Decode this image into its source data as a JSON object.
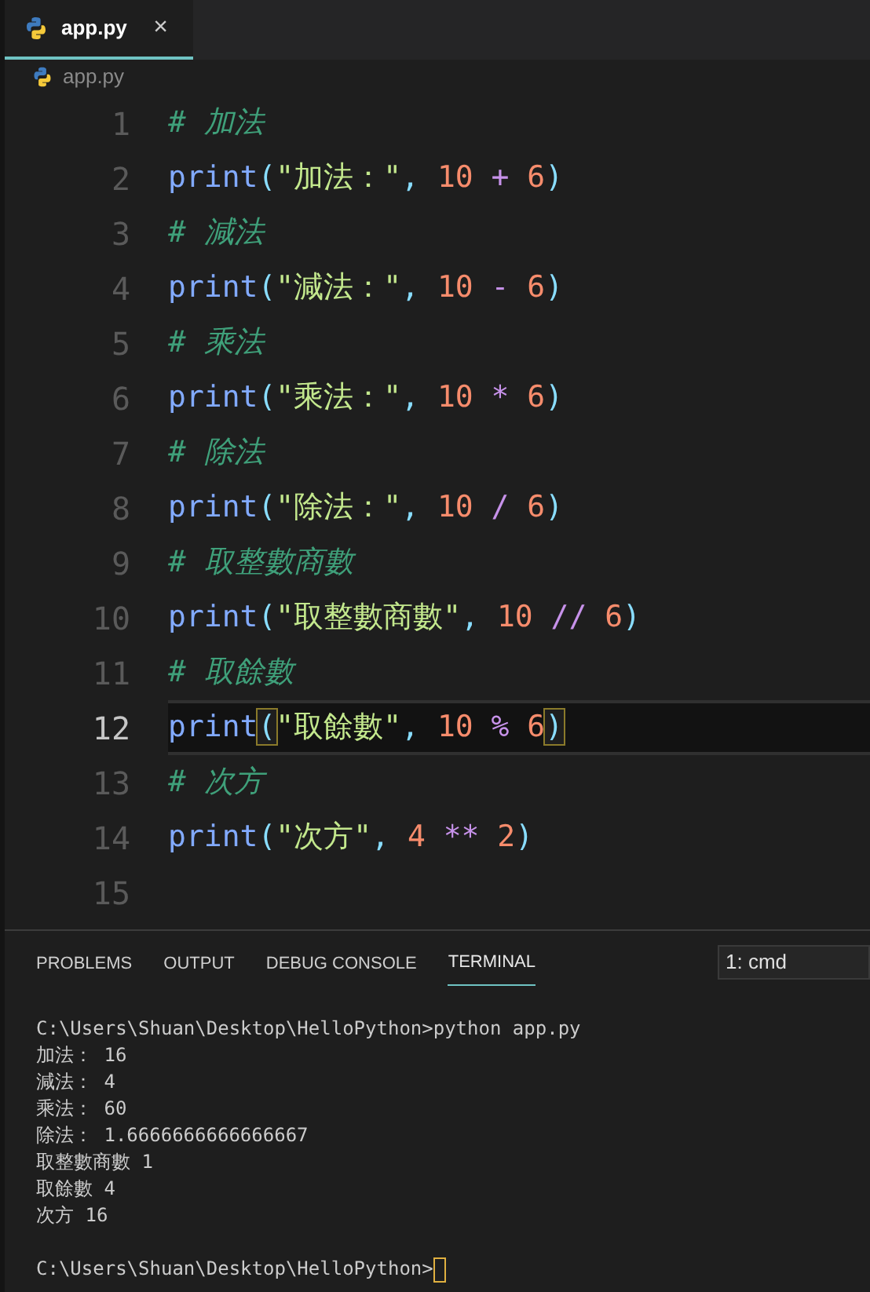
{
  "tabs": [
    {
      "label": "app.py",
      "selected": true,
      "close": "×"
    }
  ],
  "breadcrumb": "app.py",
  "code_lines": [
    {
      "number": "1",
      "current": false,
      "tokens": [
        {
          "kind": "comment",
          "text": "# 加法"
        }
      ]
    },
    {
      "number": "2",
      "current": false,
      "tokens": [
        {
          "kind": "func",
          "text": "print"
        },
        {
          "kind": "paren",
          "text": "(",
          "matched": false
        },
        {
          "kind": "string",
          "text": "\"加法：\""
        },
        {
          "kind": "punct",
          "text": ", "
        },
        {
          "kind": "number",
          "text": "10"
        },
        {
          "kind": "op",
          "text": " + "
        },
        {
          "kind": "number",
          "text": "6"
        },
        {
          "kind": "paren",
          "text": ")",
          "matched": false
        }
      ]
    },
    {
      "number": "3",
      "current": false,
      "tokens": [
        {
          "kind": "comment",
          "text": "# 減法"
        }
      ]
    },
    {
      "number": "4",
      "current": false,
      "tokens": [
        {
          "kind": "func",
          "text": "print"
        },
        {
          "kind": "paren",
          "text": "(",
          "matched": false
        },
        {
          "kind": "string",
          "text": "\"減法：\""
        },
        {
          "kind": "punct",
          "text": ", "
        },
        {
          "kind": "number",
          "text": "10"
        },
        {
          "kind": "op",
          "text": " - "
        },
        {
          "kind": "number",
          "text": "6"
        },
        {
          "kind": "paren",
          "text": ")",
          "matched": false
        }
      ]
    },
    {
      "number": "5",
      "current": false,
      "tokens": [
        {
          "kind": "comment",
          "text": "# 乘法"
        }
      ]
    },
    {
      "number": "6",
      "current": false,
      "tokens": [
        {
          "kind": "func",
          "text": "print"
        },
        {
          "kind": "paren",
          "text": "(",
          "matched": false
        },
        {
          "kind": "string",
          "text": "\"乘法：\""
        },
        {
          "kind": "punct",
          "text": ", "
        },
        {
          "kind": "number",
          "text": "10"
        },
        {
          "kind": "op",
          "text": " * "
        },
        {
          "kind": "number",
          "text": "6"
        },
        {
          "kind": "paren",
          "text": ")",
          "matched": false
        }
      ]
    },
    {
      "number": "7",
      "current": false,
      "tokens": [
        {
          "kind": "comment",
          "text": "# 除法"
        }
      ]
    },
    {
      "number": "8",
      "current": false,
      "tokens": [
        {
          "kind": "func",
          "text": "print"
        },
        {
          "kind": "paren",
          "text": "(",
          "matched": false
        },
        {
          "kind": "string",
          "text": "\"除法：\""
        },
        {
          "kind": "punct",
          "text": ", "
        },
        {
          "kind": "number",
          "text": "10"
        },
        {
          "kind": "op",
          "text": " / "
        },
        {
          "kind": "number",
          "text": "6"
        },
        {
          "kind": "paren",
          "text": ")",
          "matched": false
        }
      ]
    },
    {
      "number": "9",
      "current": false,
      "tokens": [
        {
          "kind": "comment",
          "text": "# 取整數商數"
        }
      ]
    },
    {
      "number": "10",
      "current": false,
      "tokens": [
        {
          "kind": "func",
          "text": "print"
        },
        {
          "kind": "paren",
          "text": "(",
          "matched": false
        },
        {
          "kind": "string",
          "text": "\"取整數商數\""
        },
        {
          "kind": "punct",
          "text": ", "
        },
        {
          "kind": "number",
          "text": "10"
        },
        {
          "kind": "op",
          "text": " // "
        },
        {
          "kind": "number",
          "text": "6"
        },
        {
          "kind": "paren",
          "text": ")",
          "matched": false
        }
      ]
    },
    {
      "number": "11",
      "current": false,
      "tokens": [
        {
          "kind": "comment",
          "text": "# 取餘數"
        }
      ]
    },
    {
      "number": "12",
      "current": true,
      "tokens": [
        {
          "kind": "func",
          "text": "print"
        },
        {
          "kind": "paren",
          "text": "(",
          "matched": true
        },
        {
          "kind": "string",
          "text": "\"取餘數\""
        },
        {
          "kind": "punct",
          "text": ", "
        },
        {
          "kind": "number",
          "text": "10"
        },
        {
          "kind": "op",
          "text": " % "
        },
        {
          "kind": "number",
          "text": "6"
        },
        {
          "kind": "paren",
          "text": ")",
          "matched": true
        }
      ]
    },
    {
      "number": "13",
      "current": false,
      "tokens": [
        {
          "kind": "comment",
          "text": "# 次方"
        }
      ]
    },
    {
      "number": "14",
      "current": false,
      "tokens": [
        {
          "kind": "func",
          "text": "print"
        },
        {
          "kind": "paren",
          "text": "(",
          "matched": false
        },
        {
          "kind": "string",
          "text": "\"次方\""
        },
        {
          "kind": "punct",
          "text": ", "
        },
        {
          "kind": "number",
          "text": "4"
        },
        {
          "kind": "op",
          "text": " ** "
        },
        {
          "kind": "number",
          "text": "2"
        },
        {
          "kind": "paren",
          "text": ")",
          "matched": false
        }
      ]
    },
    {
      "number": "15",
      "current": false
    }
  ],
  "panel_tabs": [
    {
      "label": "PROBLEMS",
      "selected": false
    },
    {
      "label": "OUTPUT",
      "selected": false
    },
    {
      "label": "DEBUG CONSOLE",
      "selected": false
    },
    {
      "label": "TERMINAL",
      "selected": true
    }
  ],
  "terminal_select": "1: cmd",
  "terminal": {
    "output": [
      "C:\\Users\\Shuan\\Desktop\\HelloPython>python app.py",
      "加法： 16",
      "減法： 4",
      "乘法： 60",
      "除法： 1.6666666666666667",
      "取整數商數 1",
      "取餘數 4",
      "次方 16"
    ],
    "prompt": "C:\\Users\\Shuan\\Desktop\\HelloPython>"
  }
}
